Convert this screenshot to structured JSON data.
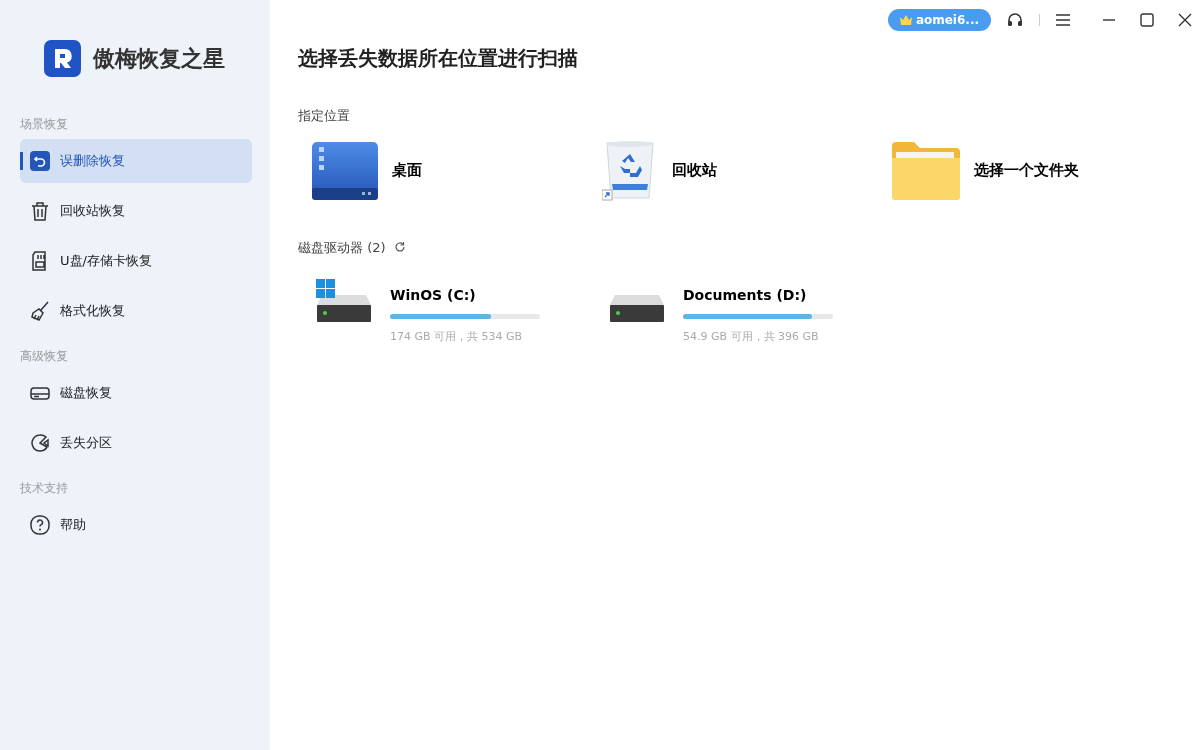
{
  "app": {
    "name": "傲梅恢复之星"
  },
  "sidebar": {
    "groups": [
      {
        "title": "场景恢复",
        "items": [
          {
            "label": "误删除恢复",
            "kind": "undo",
            "selected": true
          },
          {
            "label": "回收站恢复",
            "kind": "trash",
            "selected": false
          },
          {
            "label": "U盘/存储卡恢复",
            "kind": "card",
            "selected": false
          },
          {
            "label": "格式化恢复",
            "kind": "broom",
            "selected": false
          }
        ]
      },
      {
        "title": "高级恢复",
        "items": [
          {
            "label": "磁盘恢复",
            "kind": "disk",
            "selected": false
          },
          {
            "label": "丢失分区",
            "kind": "partition",
            "selected": false
          }
        ]
      },
      {
        "title": "技术支持",
        "items": [
          {
            "label": "帮助",
            "kind": "help",
            "selected": false
          }
        ]
      }
    ]
  },
  "titlebar": {
    "account": "aomei6..."
  },
  "heading": "选择丢失数据所在位置进行扫描",
  "locations": {
    "title": "指定位置",
    "items": [
      {
        "label": "桌面",
        "kind": "desktop"
      },
      {
        "label": "回收站",
        "kind": "recycle"
      },
      {
        "label": "选择一个文件夹",
        "kind": "folder"
      }
    ]
  },
  "drives": {
    "title": "磁盘驱动器 (2)",
    "items": [
      {
        "name": "WinOS (C:)",
        "kind": "system",
        "level": 0.67,
        "reading": "174 GB 可用，共 534 GB"
      },
      {
        "name": "Documents (D:)",
        "kind": "data",
        "level": 0.86,
        "reading": "54.9 GB 可用，共 396 GB"
      }
    ]
  }
}
